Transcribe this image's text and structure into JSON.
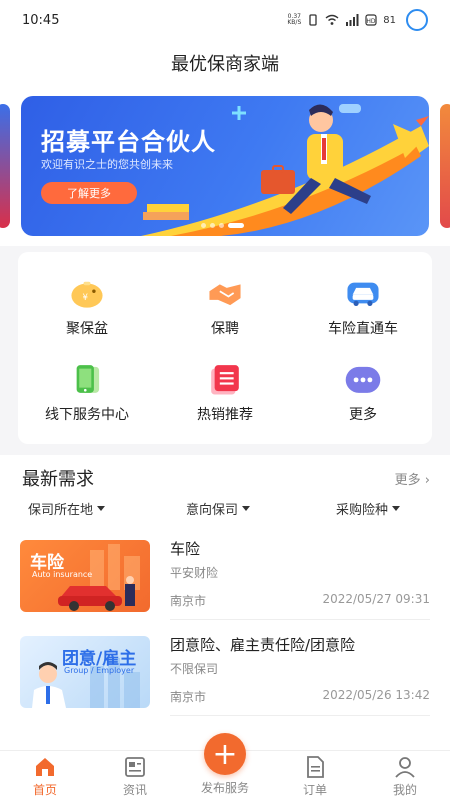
{
  "status": {
    "time": "10:45",
    "net_speed_top": "0.37",
    "net_speed_bottom": "KB/S",
    "battery": "81"
  },
  "header": {
    "title": "最优保商家端"
  },
  "banner": {
    "title": "招募平台合伙人",
    "subtitle": "欢迎有识之士的您共创未来",
    "button": "了解更多"
  },
  "grid": {
    "items": [
      {
        "label": "聚保盆",
        "icon": "piggy-bank-icon"
      },
      {
        "label": "保聘",
        "icon": "handshake-icon"
      },
      {
        "label": "车险直通车",
        "icon": "car-icon"
      },
      {
        "label": "线下服务中心",
        "icon": "phone-icon"
      },
      {
        "label": "热销推荐",
        "icon": "list-icon"
      },
      {
        "label": "更多",
        "icon": "more-icon"
      }
    ]
  },
  "section": {
    "title": "最新需求",
    "more": "更多",
    "filters": [
      "保司所在地",
      "意向保司",
      "采购险种"
    ]
  },
  "demands": [
    {
      "thumb_title": "车险",
      "thumb_sub": "Auto insurance",
      "title": "车险",
      "company": "平安财险",
      "city": "南京市",
      "date": "2022/05/27 09:31"
    },
    {
      "thumb_title": "团意/雇主",
      "thumb_sub": "Group / Employer",
      "title": "团意险、雇主责任险/团意险",
      "company": "不限保司",
      "city": "南京市",
      "date": "2022/05/26 13:42"
    }
  ],
  "tabbar": {
    "tabs": [
      "首页",
      "资讯",
      "发布服务",
      "订单",
      "我的"
    ],
    "publish_symbol": "+"
  },
  "colors": {
    "accent": "#f26a2e",
    "banner_blue": "#3f7af2"
  }
}
